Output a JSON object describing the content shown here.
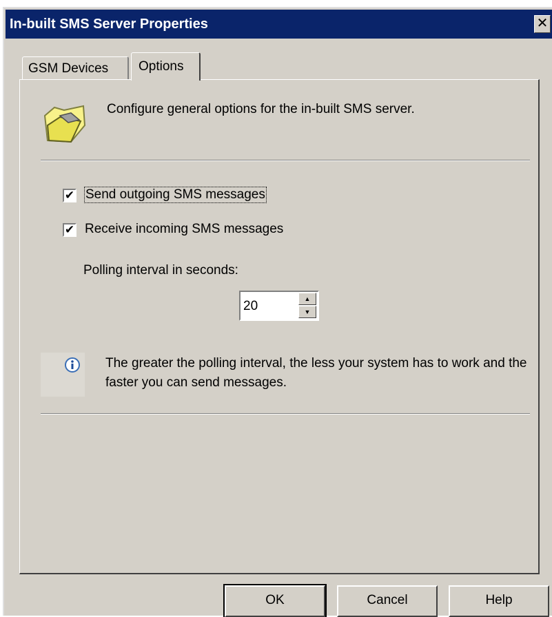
{
  "window": {
    "title": "In-built SMS Server Properties",
    "close_glyph": "✕"
  },
  "tabs": [
    {
      "label": "GSM Devices",
      "active": false
    },
    {
      "label": "Options",
      "active": true
    }
  ],
  "header": {
    "icon": "folder-icon",
    "text": "Configure general options for the in-built SMS server."
  },
  "options": {
    "send_label": "Send outgoing SMS messages",
    "send_checked": true,
    "receive_label": "Receive incoming SMS messages",
    "receive_checked": true,
    "check_glyph": "✔"
  },
  "polling": {
    "label": "Polling interval in seconds:",
    "value": "20",
    "up_glyph": "▲",
    "down_glyph": "▼"
  },
  "info": {
    "icon": "info-icon",
    "text": "The greater the polling interval, the less your system has to work and the faster you can send messages."
  },
  "buttons": {
    "ok": "OK",
    "cancel": "Cancel",
    "help": "Help"
  },
  "colors": {
    "titlebar": "#0a246a",
    "face": "#d4d0c8"
  }
}
